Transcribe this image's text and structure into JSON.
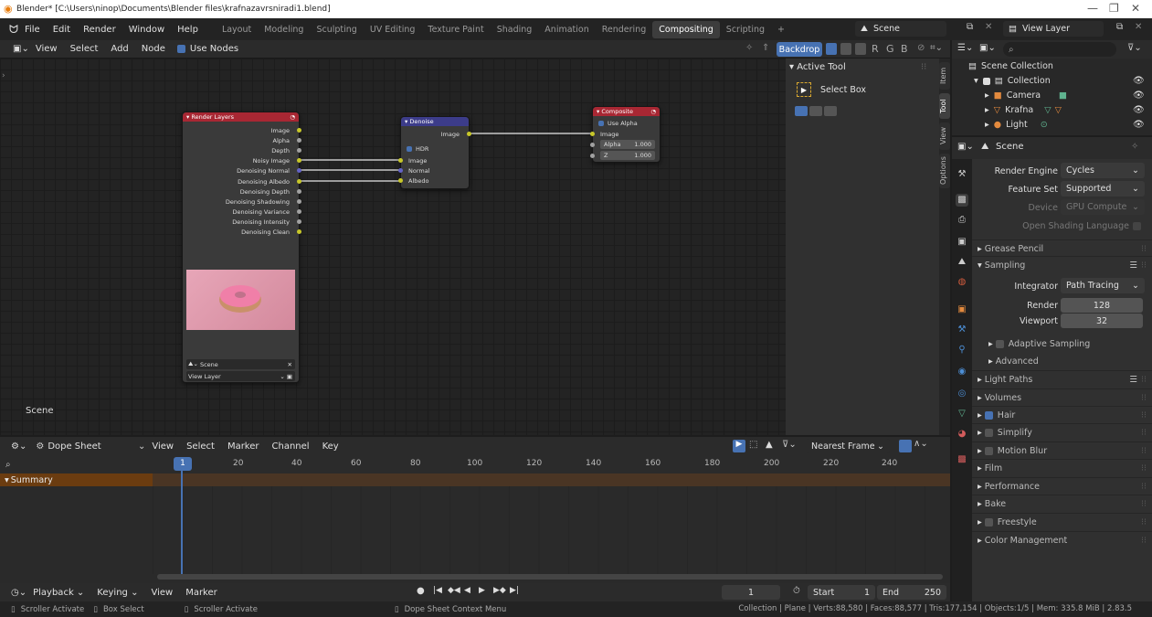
{
  "window": {
    "title": "Blender* [C:\\Users\\ninop\\Documents\\Blender files\\krafnazavrsniradi1.blend]"
  },
  "menu": [
    "File",
    "Edit",
    "Render",
    "Window",
    "Help"
  ],
  "workspaces": [
    "Layout",
    "Modeling",
    "Sculpting",
    "UV Editing",
    "Texture Paint",
    "Shading",
    "Animation",
    "Rendering",
    "Compositing",
    "Scripting",
    "+"
  ],
  "active_workspace": "Compositing",
  "scene_field": "Scene",
  "view_layer_field": "View Layer",
  "node_editor": {
    "menu": [
      "View",
      "Select",
      "Add",
      "Node"
    ],
    "use_nodes_label": "Use Nodes",
    "backdrop_label": "Backdrop",
    "channels": [
      "R",
      "G",
      "B"
    ],
    "scene_label": "Scene",
    "nodes": {
      "render_layers": {
        "title": "Render Layers",
        "outputs": [
          "Image",
          "Alpha",
          "Depth",
          "Noisy Image",
          "Denoising Normal",
          "Denoising Albedo",
          "Denoising Depth",
          "Denoising Shadowing",
          "Denoising Variance",
          "Denoising Intensity",
          "Denoising Clean"
        ],
        "scene": "Scene",
        "layer": "View Layer"
      },
      "denoise": {
        "title": "Denoise",
        "output": "Image",
        "hdr_label": "HDR",
        "inputs": [
          "Image",
          "Normal",
          "Albedo"
        ]
      },
      "composite": {
        "title": "Composite",
        "use_alpha": "Use Alpha",
        "input": "Image",
        "alpha_label": "Alpha",
        "alpha_value": "1.000",
        "z_label": "Z",
        "z_value": "1.000"
      }
    }
  },
  "npanel": {
    "header": "Active Tool",
    "tool": "Select Box",
    "tabs": [
      "Item",
      "Tool",
      "View",
      "Options"
    ]
  },
  "dopesheet": {
    "mode": "Dope Sheet",
    "menu": [
      "View",
      "Select",
      "Marker",
      "Channel",
      "Key"
    ],
    "snap": "Nearest Frame",
    "current_frame": "1",
    "ruler": [
      "20",
      "40",
      "60",
      "80",
      "100",
      "120",
      "140",
      "160",
      "180",
      "200",
      "220",
      "240"
    ],
    "summary": "Summary"
  },
  "timeline": {
    "menu": [
      "Playback",
      "Keying",
      "View",
      "Marker"
    ],
    "frame": "1",
    "start_label": "Start",
    "start": "1",
    "end_label": "End",
    "end": "250"
  },
  "statusbar": {
    "left": [
      "Scroller Activate",
      "Box Select",
      "Scroller Activate",
      "Dope Sheet Context Menu"
    ],
    "right": "Collection | Plane | Verts:88,580 | Faces:88,577 | Tris:177,154 | Objects:1/5 | Mem: 335.8 MiB | 2.83.5"
  },
  "outliner": {
    "root": "Scene Collection",
    "collection": "Collection",
    "items": [
      "Camera",
      "Krafna",
      "Light"
    ]
  },
  "properties": {
    "scene": "Scene",
    "render_engine_label": "Render Engine",
    "render_engine": "Cycles",
    "feature_set_label": "Feature Set",
    "feature_set": "Supported",
    "device_label": "Device",
    "device": "GPU Compute",
    "osl_label": "Open Shading Language",
    "sections_top": [
      "Grease Pencil",
      "Sampling"
    ],
    "integrator_label": "Integrator",
    "integrator": "Path Tracing",
    "render_label": "Render",
    "render_samples": "128",
    "viewport_label": "Viewport",
    "viewport_samples": "32",
    "sub": [
      "Adaptive Sampling",
      "Advanced"
    ],
    "sections": [
      "Light Paths",
      "Volumes",
      "Hair",
      "Simplify",
      "Motion Blur",
      "Film",
      "Performance",
      "Bake",
      "Freestyle",
      "Color Management"
    ]
  },
  "colors": {
    "accent": "#4772b3",
    "node_red": "#a82733",
    "node_purple": "#3c3c8a",
    "socket_yellow": "#c7c729"
  }
}
